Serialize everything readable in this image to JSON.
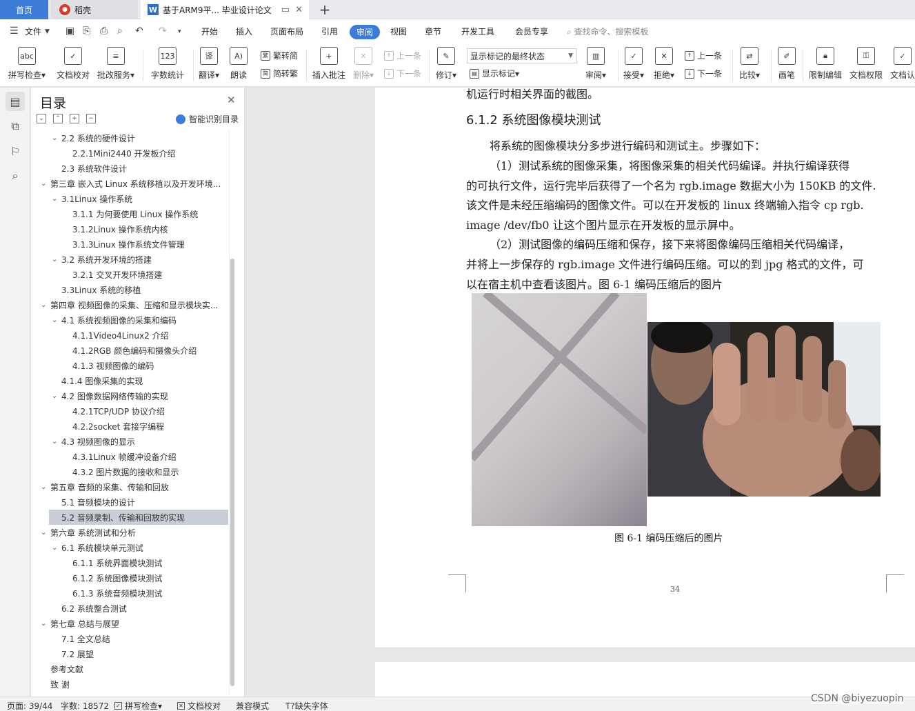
{
  "tabs": {
    "home": "首页",
    "daoke": "稻壳",
    "doc": "基于ARM9平... 毕业设计论文",
    "new": "+"
  },
  "menu": {
    "file": "文件",
    "items": [
      "开始",
      "插入",
      "页面布局",
      "引用",
      "审阅",
      "视图",
      "章节",
      "开发工具",
      "会员专享"
    ],
    "active": "审阅",
    "search": "查找命令、搜索模板"
  },
  "ribbon": {
    "spell": "拼写检查",
    "proof": "文档校对",
    "batch": "批改服务",
    "wordcount": "字数统计",
    "translate": "翻译",
    "read": "朗读",
    "trad": "繁转简",
    "simp": "简转繁",
    "insert_comment": "插入批注",
    "delete": "删除",
    "prev": "上一条",
    "next": "下一条",
    "revise": "修订",
    "markup_state": "显示标记的最终状态",
    "show_markup": "显示标记",
    "review": "审阅",
    "accept": "接受",
    "reject": "拒绝",
    "prev2": "上一条",
    "next2": "下一条",
    "compare": "比较",
    "pen": "画笔",
    "restrict": "限制编辑",
    "rights": "文档权限",
    "cert": "文档认"
  },
  "toc": {
    "title": "目录",
    "smart": "智能识别目录",
    "items": [
      {
        "label": "2.2 系统的硬件设计",
        "level": 1,
        "chev": true
      },
      {
        "label": "2.2.1Mini2440 开发板介绍",
        "level": 2,
        "chev": false
      },
      {
        "label": "2.3  系统软件设计",
        "level": 1,
        "chev": false
      },
      {
        "label": "第三章  嵌入式 Linux 系统移植以及开发环境...",
        "level": 0,
        "chev": true
      },
      {
        "label": "3.1Linux 操作系统",
        "level": 1,
        "chev": true
      },
      {
        "label": "3.1.1 为何要使用 Linux 操作系统",
        "level": 2,
        "chev": false
      },
      {
        "label": "3.1.2Linux 操作系统内核",
        "level": 2,
        "chev": false
      },
      {
        "label": "3.1.3Linux 操作系统文件管理",
        "level": 2,
        "chev": false
      },
      {
        "label": "3.2  系统开发环境的搭建",
        "level": 1,
        "chev": true
      },
      {
        "label": "3.2.1 交叉开发环境搭建",
        "level": 2,
        "chev": false
      },
      {
        "label": "3.3Linux 系统的移植",
        "level": 1,
        "chev": false
      },
      {
        "label": "第四章  视频图像的采集、压缩和显示模块实...",
        "level": 0,
        "chev": true
      },
      {
        "label": "4.1 系统视频图像的采集和编码",
        "level": 1,
        "chev": true
      },
      {
        "label": "4.1.1Video4Linux2 介绍",
        "level": 2,
        "chev": false
      },
      {
        "label": "4.1.2RGB 颜色编码和摄像头介绍",
        "level": 2,
        "chev": false
      },
      {
        "label": "4.1.3 视频图像的编码",
        "level": 2,
        "chev": false
      },
      {
        "label": "4.1.4 图像采集的实现",
        "level": 1,
        "chev": false
      },
      {
        "label": "4.2 图像数据网络传输的实现",
        "level": 1,
        "chev": true
      },
      {
        "label": "4.2.1TCP/UDP 协议介绍",
        "level": 2,
        "chev": false
      },
      {
        "label": "4.2.2socket 套接字编程",
        "level": 2,
        "chev": false
      },
      {
        "label": "4.3 视频图像的显示",
        "level": 1,
        "chev": true
      },
      {
        "label": "4.3.1Linux 帧缓冲设备介绍",
        "level": 2,
        "chev": false
      },
      {
        "label": "4.3.2 图片数据的接收和显示",
        "level": 2,
        "chev": false
      },
      {
        "label": "第五章  音频的采集、传输和回放",
        "level": 0,
        "chev": true
      },
      {
        "label": "5.1 音频模块的设计",
        "level": 1,
        "chev": false
      },
      {
        "label": "5.2 音频录制、传输和回放的实现",
        "level": 1,
        "chev": false,
        "active": true
      },
      {
        "label": "第六章  系统测试和分析",
        "level": 0,
        "chev": true
      },
      {
        "label": "6.1 系统模块单元测试",
        "level": 1,
        "chev": true
      },
      {
        "label": "6.1.1 系统界面模块测试",
        "level": 2,
        "chev": false
      },
      {
        "label": "6.1.2 系统图像模块测试",
        "level": 2,
        "chev": false
      },
      {
        "label": "6.1.3 系统音频模块测试",
        "level": 2,
        "chev": false
      },
      {
        "label": "6.2 系统整合测试",
        "level": 1,
        "chev": false
      },
      {
        "label": "第七章  总结与展望",
        "level": 0,
        "chev": true
      },
      {
        "label": "7.1 全文总结",
        "level": 1,
        "chev": false
      },
      {
        "label": "7.2 展望",
        "level": 1,
        "chev": false
      },
      {
        "label": "参考文献",
        "level": 0,
        "chev": false
      },
      {
        "label": "致    谢",
        "level": 0,
        "chev": false
      }
    ]
  },
  "doc": {
    "prev_line": "机运行时相关界面的截图。",
    "heading": "6.1.2 系统图像模块测试",
    "lines": [
      "将系统的图像模块分多步进行编码和测试主。步骤如下：",
      "（1）测试系统的图像采集，将图像采集的相关代码编译。并执行编译获得",
      "的可执行文件，运行完毕后获得了一个名为 rgb.image 数据大小为 150KB 的文件.",
      "该文件是未经压缩编码的图像文件。可以在开发板的 linux 终端输入指令 cp  rgb.",
      "image  /dev/fb0 让这个图片显示在开发板的显示屏中。",
      "（2）测试图像的编码压缩和保存，接下来将图像编码压缩相关代码编译，",
      "并将上一步保存的 rgb.image 文件进行编码压缩。可以的到 jpg 格式的文件，可",
      "以在宿主机中查看该图片。图 6-1 编码压缩后的图片"
    ],
    "caption": "图 6-1    编码压缩后的图片",
    "page_number": "34"
  },
  "status": {
    "page": "页面: 39/44",
    "words": "字数: 18572",
    "spell": "拼写检查",
    "proof": "文档校对",
    "compat": "兼容模式",
    "missing_font": "缺失字体"
  },
  "watermark": "CSDN @biyezuopin"
}
